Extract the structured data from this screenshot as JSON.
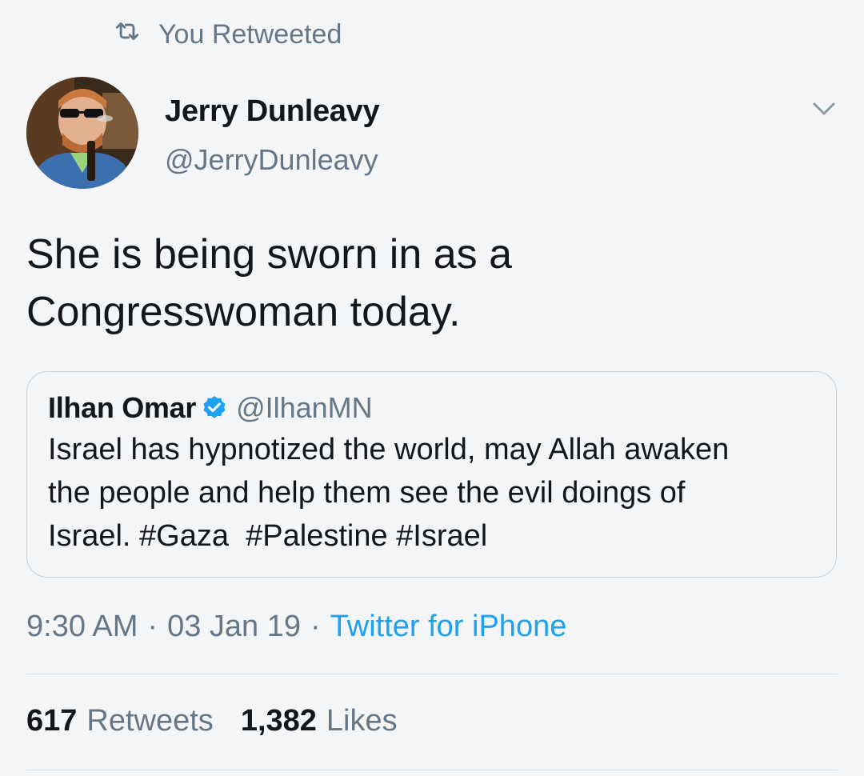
{
  "context": {
    "icon": "retweet-icon",
    "label": "You Retweeted"
  },
  "author": {
    "name": "Jerry Dunleavy",
    "handle": "@JerryDunleavy",
    "avatar_icon": "profile-photo"
  },
  "tweet": {
    "line1": "She is being sworn in as a",
    "line2": "Congresswoman today."
  },
  "quoted_tweet": {
    "name": "Ilhan Omar",
    "verified": true,
    "handle": "@IlhanMN",
    "text_line1": "Israel has hypnotized the world, may Allah awaken",
    "text_line2": "the people and help them see the evil doings of",
    "text_line3_prefix": "Israel.",
    "hashtags": [
      "#Gaza",
      "#Palestine",
      "#Israel"
    ]
  },
  "meta": {
    "time": "9:30 AM",
    "separator": "·",
    "date": "03 Jan 19",
    "source": "Twitter for iPhone"
  },
  "stats": {
    "retweets_count": "617",
    "retweets_label": "Retweets",
    "likes_count": "1,382",
    "likes_label": "Likes"
  },
  "colors": {
    "background": "#f4f5f7",
    "text": "#14171a",
    "secondary": "#657786",
    "accent": "#1da1f2"
  }
}
